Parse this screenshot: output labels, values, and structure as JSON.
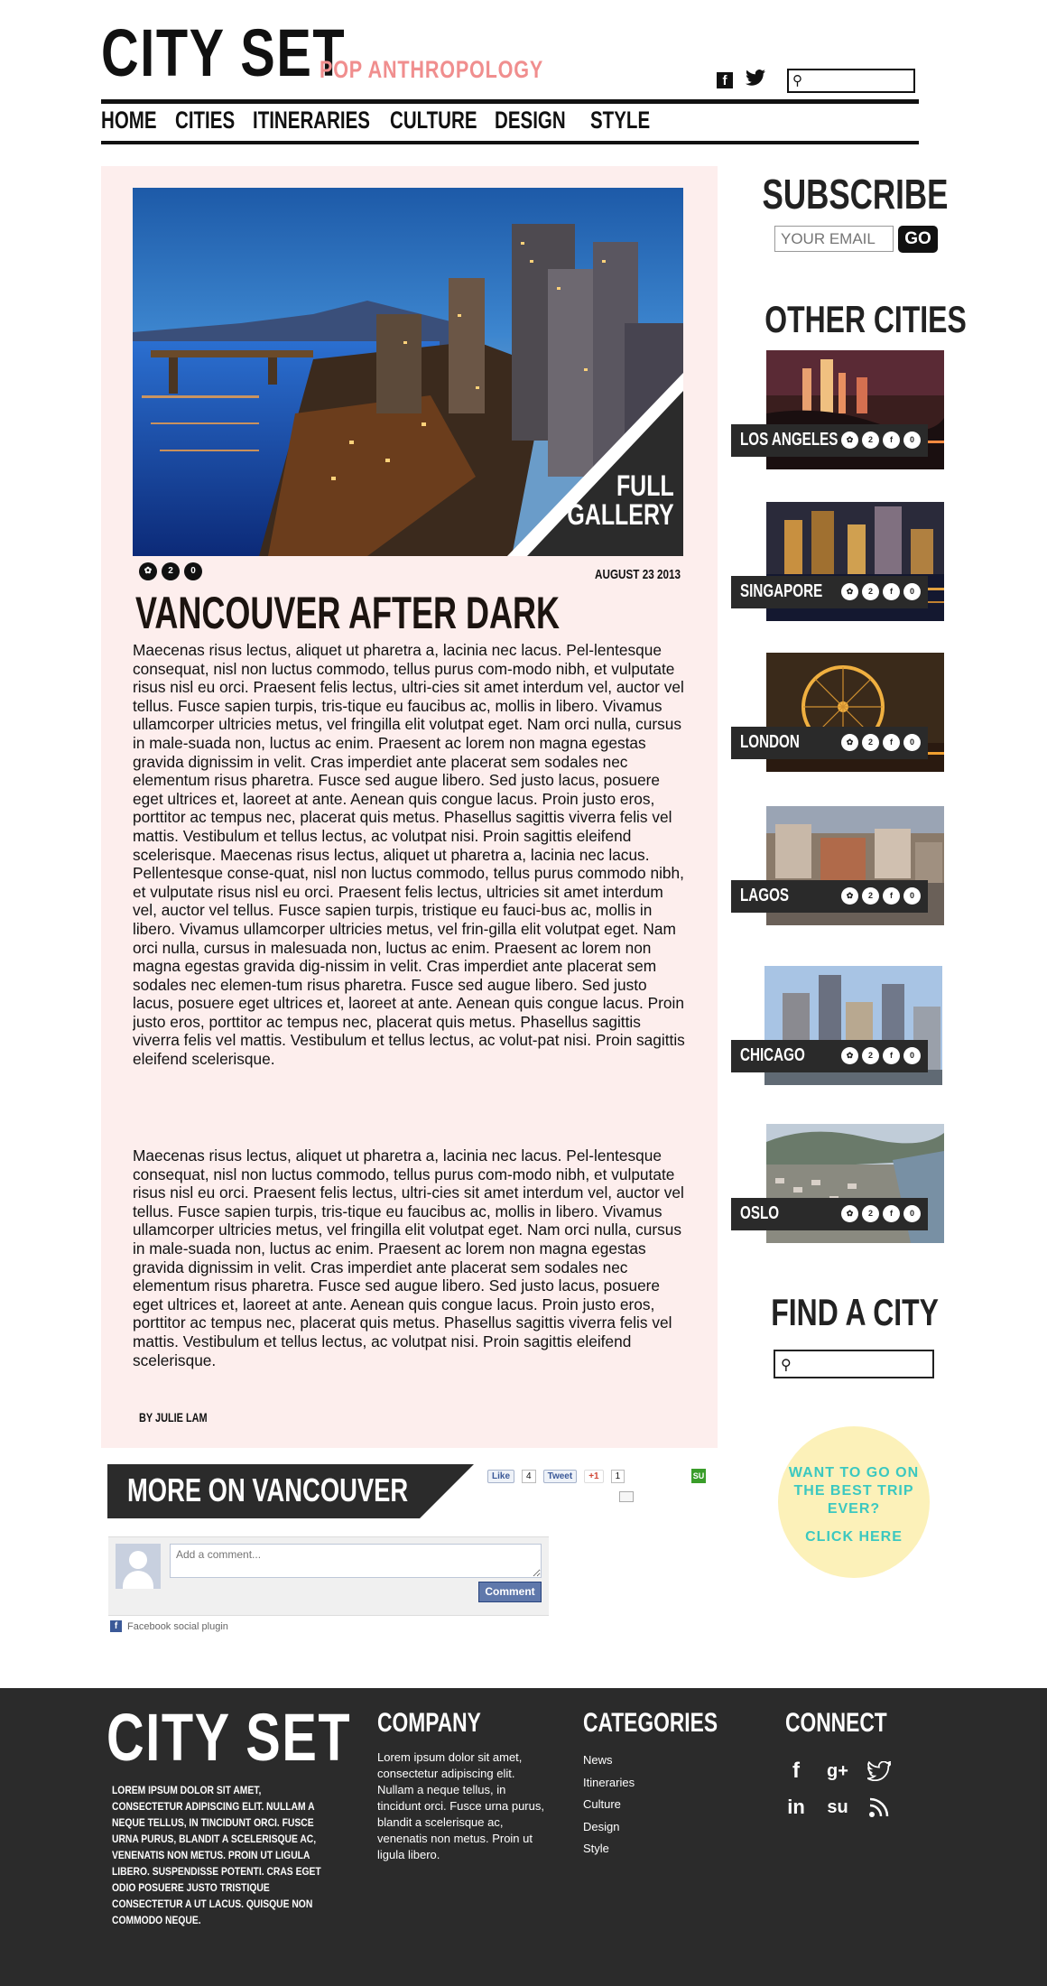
{
  "header": {
    "brand": "CITY SET",
    "tagline": "POP ANTHROPOLOGY",
    "search_placeholder": ""
  },
  "nav": {
    "items": [
      "HOME",
      "CITIES",
      "ITINERARIES",
      "CULTURE",
      "DESIGN",
      "STYLE"
    ]
  },
  "article": {
    "gallery_label_1": "FULL",
    "gallery_label_2": "GALLERY",
    "share_counts": [
      "2",
      "0"
    ],
    "date": "AUGUST 23 2013",
    "title": "VANCOUVER AFTER DARK",
    "paragraph_1": "Maecenas risus lectus, aliquet ut pharetra a, lacinia nec lacus. Pel-lentesque consequat, nisl non luctus commodo, tellus purus com-modo nibh, et vulputate risus nisl eu orci. Praesent felis lectus, ultri-cies sit amet interdum vel, auctor vel tellus. Fusce sapien turpis, tris-tique eu faucibus ac, mollis in libero. Vivamus ullamcorper ultricies metus, vel fringilla elit volutpat eget. Nam orci nulla, cursus in male-suada non, luctus ac enim. Praesent ac lorem non magna egestas gravida dignissim in velit. Cras imperdiet ante placerat sem sodales nec elementum risus pharetra. Fusce sed augue libero. Sed justo lacus, posuere eget ultrices et, laoreet at ante. Aenean quis congue lacus. Proin justo eros, porttitor ac tempus nec, placerat quis metus. Phasellus sagittis viverra felis vel mattis. Vestibulum et tellus lectus, ac volutpat nisi. Proin sagittis eleifend scelerisque.  Maecenas risus lectus, aliquet ut pharetra a, lacinia nec lacus. Pellentesque conse-quat, nisl non luctus commodo, tellus purus commodo nibh, et vulputate risus nisl eu orci. Praesent felis lectus, ultricies sit amet interdum vel, auctor vel tellus. Fusce sapien turpis, tristique eu fauci-bus ac, mollis in libero. Vivamus ullamcorper ultricies metus, vel frin-gilla elit volutpat eget. Nam orci nulla, cursus in malesuada non, luctus ac enim. Praesent ac lorem non magna egestas gravida dig-nissim in velit. Cras imperdiet ante placerat sem sodales nec elemen-tum risus pharetra. Fusce sed augue libero. Sed justo lacus, posuere eget ultrices et, laoreet at ante. Aenean quis congue lacus. Proin justo eros, porttitor ac tempus nec, placerat quis metus. Phasellus sagittis viverra felis vel mattis. Vestibulum et tellus lectus, ac volut-pat nisi. Proin sagittis eleifend scelerisque.",
    "paragraph_2": "Maecenas risus lectus, aliquet ut pharetra a, lacinia nec lacus. Pel-lentesque consequat, nisl non luctus commodo, tellus purus com-modo nibh, et vulputate risus nisl eu orci. Praesent felis lectus, ultri-cies sit amet interdum vel, auctor vel tellus. Fusce sapien turpis, tris-tique eu faucibus ac, mollis in libero. Vivamus ullamcorper ultricies metus, vel fringilla elit volutpat eget. Nam orci nulla, cursus in male-suada non, luctus ac enim. Praesent ac lorem non magna egestas gravida dignissim in velit. Cras imperdiet ante placerat sem sodales nec elementum risus pharetra. Fusce sed augue libero. Sed justo lacus, posuere eget ultrices et, laoreet at ante. Aenean quis congue lacus. Proin justo eros, porttitor ac tempus nec, placerat quis metus. Phasellus sagittis viverra felis vel mattis. Vestibulum et tellus lectus, ac volutpat nisi. Proin sagittis eleifend scelerisque.",
    "byline": "BY JULIE LAM"
  },
  "more": {
    "banner": "MORE ON VANCOUVER",
    "like_label": "Like",
    "like_count": "4",
    "tweet_label": "Tweet",
    "plus_label": "+1",
    "plus_count": "1",
    "stumble_label": "SU"
  },
  "comments": {
    "placeholder": "Add a comment...",
    "button": "Comment",
    "plugin_label": "Facebook social plugin"
  },
  "sidebar": {
    "subscribe_head": "SUBSCRIBE",
    "email_placeholder": "YOUR EMAIL",
    "go_label": "GO",
    "other_cities_head": "OTHER CITIES",
    "cities": [
      {
        "name": "LOS ANGELES",
        "counts": [
          "2",
          "0"
        ]
      },
      {
        "name": "SINGAPORE",
        "counts": [
          "2",
          "0"
        ]
      },
      {
        "name": "LONDON",
        "counts": [
          "2",
          "0"
        ]
      },
      {
        "name": "LAGOS",
        "counts": [
          "2",
          "0"
        ]
      },
      {
        "name": "CHICAGO",
        "counts": [
          "2",
          "0"
        ]
      },
      {
        "name": "OSLO",
        "counts": [
          "2",
          "0"
        ]
      }
    ],
    "find_head": "FIND A CITY",
    "trip_text": "WANT TO GO ON THE BEST TRIP EVER?",
    "trip_link": "CLICK HERE"
  },
  "footer": {
    "brand": "CITY SET",
    "blurb": "Lorem ipsum dolor sit amet, consectetur adipiscing elit. Nullam a neque tellus, in tincidunt orci. Fusce urna purus, blandit a scelerisque ac, venenatis non metus. Proin ut ligula libero. Suspendisse potenti. Cras eget odio posuere justo tristique consectetur a ut lacus. Quisque non commodo neque.",
    "company_head": "COMPANY",
    "company_text": "Lorem ipsum dolor sit amet, consectetur adipiscing elit. Nullam a neque tellus, in tincidunt orci. Fusce urna purus, blandit a scelerisque ac, venenatis non metus. Proin ut ligula libero.",
    "categories_head": "CATEGORIES",
    "categories": [
      "News",
      "Itineraries",
      "Culture",
      "Design",
      "Style"
    ],
    "connect_head": "CONNECT",
    "connect_icons": [
      "facebook-icon",
      "google-plus-icon",
      "twitter-icon",
      "linkedin-icon",
      "stumbleupon-icon",
      "rss-icon"
    ]
  },
  "colors": {
    "accent_pink": "#f08e8e",
    "panel_bg": "#fdeeed",
    "dark": "#2b2b2b",
    "teal": "#3bc8c0",
    "cream": "#fcf1b9"
  }
}
